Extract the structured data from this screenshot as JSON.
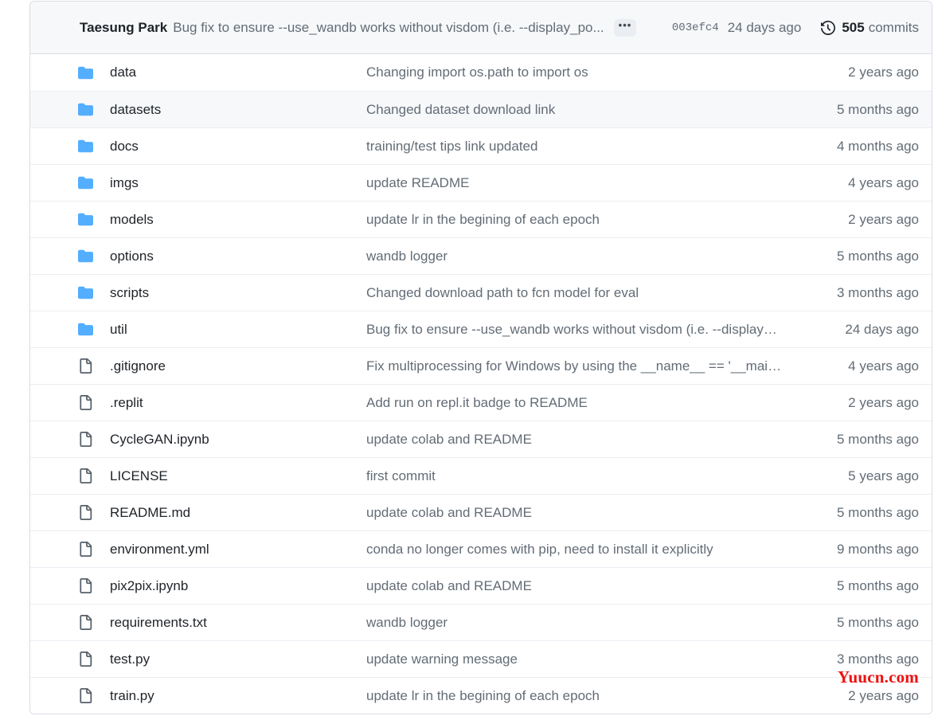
{
  "latest_commit": {
    "author": "Taesung Park",
    "message": "Bug fix to ensure --use_wandb works without visdom (i.e. --display_po...",
    "ellipsis_label": "•••",
    "sha": "003efc4",
    "relative_date": "24 days ago",
    "commits_count": "505",
    "commits_label": "commits",
    "history_icon": "history-clock-icon"
  },
  "colors": {
    "folder_blue": "#54aeff",
    "file_gray": "#57606a",
    "border": "#d8dee4",
    "row_border": "#eaeef2",
    "header_bg": "#f6f8fa",
    "hover_bg": "#f6f8fa",
    "text_primary": "#1f2328",
    "text_muted": "#636c76",
    "watermark_red": "#ee1111"
  },
  "watermark": "Yuucn.com",
  "files": [
    {
      "icon": "folder-icon",
      "type": "directory",
      "name": "data",
      "message": "Changing import os.path to import os",
      "time": "2 years ago",
      "hovered": false
    },
    {
      "icon": "folder-icon",
      "type": "directory",
      "name": "datasets",
      "message": "Changed dataset download link",
      "time": "5 months ago",
      "hovered": true
    },
    {
      "icon": "folder-icon",
      "type": "directory",
      "name": "docs",
      "message": "training/test tips link updated",
      "time": "4 months ago",
      "hovered": false
    },
    {
      "icon": "folder-icon",
      "type": "directory",
      "name": "imgs",
      "message": "update README",
      "time": "4 years ago",
      "hovered": false
    },
    {
      "icon": "folder-icon",
      "type": "directory",
      "name": "models",
      "message": "update lr in the begining of each epoch",
      "time": "2 years ago",
      "hovered": false
    },
    {
      "icon": "folder-icon",
      "type": "directory",
      "name": "options",
      "message": "wandb logger",
      "time": "5 months ago",
      "hovered": false
    },
    {
      "icon": "folder-icon",
      "type": "directory",
      "name": "scripts",
      "message": "Changed download path to fcn model for eval",
      "time": "3 months ago",
      "hovered": false
    },
    {
      "icon": "folder-icon",
      "type": "directory",
      "name": "util",
      "message": "Bug fix to ensure --use_wandb works without visdom (i.e. --display_po...",
      "time": "24 days ago",
      "hovered": false
    },
    {
      "icon": "file-icon",
      "type": "file",
      "name": ".gitignore",
      "message": "Fix multiprocessing for Windows by using the __name__ == '__main__' i...",
      "time": "4 years ago",
      "hovered": false
    },
    {
      "icon": "file-icon",
      "type": "file",
      "name": ".replit",
      "message": "Add run on repl.it badge to README",
      "time": "2 years ago",
      "hovered": false
    },
    {
      "icon": "file-icon",
      "type": "file",
      "name": "CycleGAN.ipynb",
      "message": "update colab and README",
      "time": "5 months ago",
      "hovered": false
    },
    {
      "icon": "file-icon",
      "type": "file",
      "name": "LICENSE",
      "message": "first commit",
      "time": "5 years ago",
      "hovered": false
    },
    {
      "icon": "file-icon",
      "type": "file",
      "name": "README.md",
      "message": "update colab and README",
      "time": "5 months ago",
      "hovered": false
    },
    {
      "icon": "file-icon",
      "type": "file",
      "name": "environment.yml",
      "message": "conda no longer comes with pip, need to install it explicitly",
      "time": "9 months ago",
      "hovered": false
    },
    {
      "icon": "file-icon",
      "type": "file",
      "name": "pix2pix.ipynb",
      "message": "update colab and README",
      "time": "5 months ago",
      "hovered": false
    },
    {
      "icon": "file-icon",
      "type": "file",
      "name": "requirements.txt",
      "message": "wandb logger",
      "time": "5 months ago",
      "hovered": false
    },
    {
      "icon": "file-icon",
      "type": "file",
      "name": "test.py",
      "message": "update warning message",
      "time": "3 months ago",
      "hovered": false
    },
    {
      "icon": "file-icon",
      "type": "file",
      "name": "train.py",
      "message": "update lr in the begining of each epoch",
      "time": "2 years ago",
      "hovered": false
    }
  ]
}
